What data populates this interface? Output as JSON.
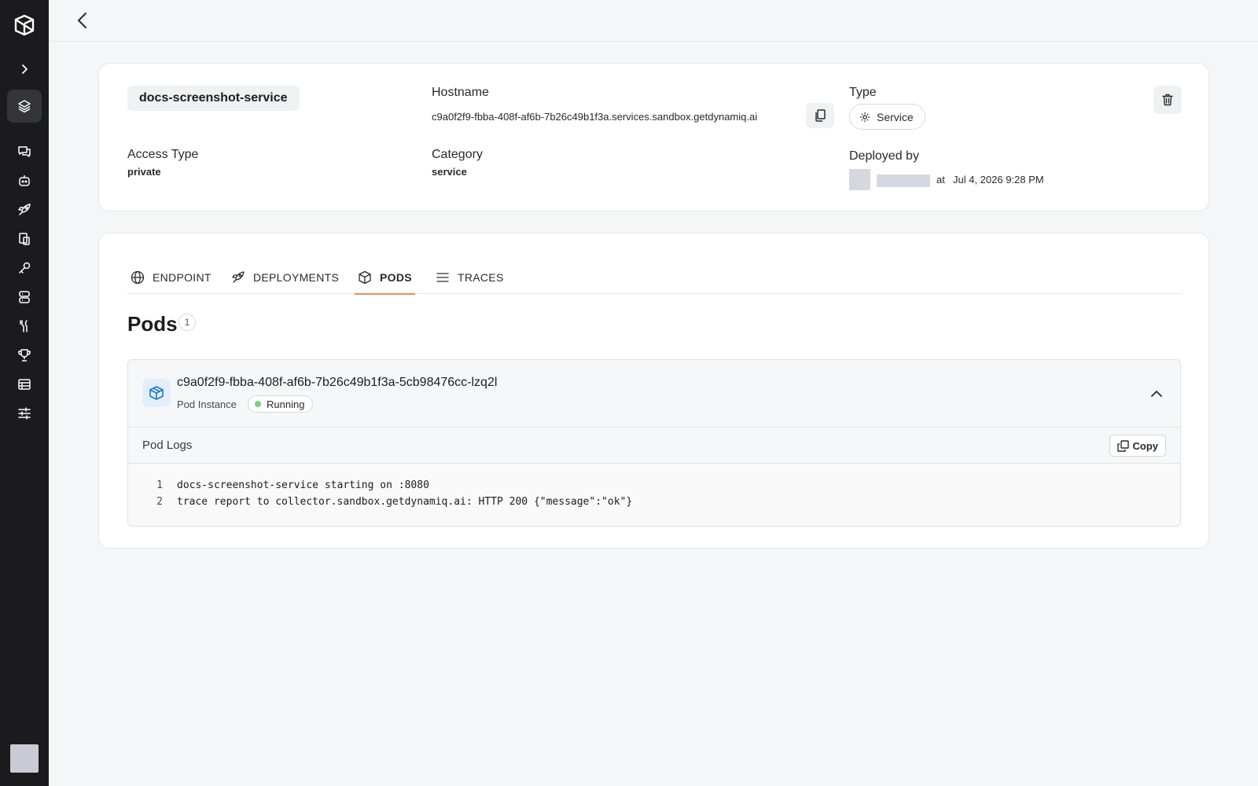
{
  "service": {
    "name": "docs-screenshot-service",
    "hostname_label": "Hostname",
    "hostname": "c9a0f2f9-fbba-408f-af6b-7b26c49b1f3a.services.sandbox.getdynamiq.ai",
    "type_label": "Type",
    "type_value": "Service",
    "access_type_label": "Access Type",
    "access_type": "private",
    "category_label": "Category",
    "category": "service",
    "deployed_by_label": "Deployed by",
    "deployed_at_prefix": "at",
    "deployed_at": "Jul 4, 2026 9:28 PM"
  },
  "tabs": [
    {
      "label": "ENDPOINT",
      "icon": "globe-icon"
    },
    {
      "label": "DEPLOYMENTS",
      "icon": "rocket-icon"
    },
    {
      "label": "PODS",
      "icon": "cube-icon",
      "active": true
    },
    {
      "label": "TRACES",
      "icon": "list-icon"
    }
  ],
  "pods": {
    "title": "Pods",
    "count": "1",
    "items": [
      {
        "name": "c9a0f2f9-fbba-408f-af6b-7b26c49b1f3a-5cb98476cc-lzq2l",
        "subtitle": "Pod Instance",
        "status": "Running",
        "status_color": "#7ccf7f"
      }
    ]
  },
  "logs": {
    "title": "Pod Logs",
    "copy_label": "Copy",
    "lines": [
      {
        "num": "1",
        "text": "docs-screenshot-service starting on :8080"
      },
      {
        "num": "2",
        "text": "trace report to collector.sandbox.getdynamiq.ai: HTTP 200 {\"message\":\"ok\"}"
      }
    ]
  },
  "sidebar": {
    "items": [
      "layers-icon",
      "chat-icon",
      "bot-icon",
      "rocket-icon",
      "documents-icon",
      "key-icon",
      "database-icon",
      "tools-icon",
      "trophy-icon",
      "table-icon",
      "sliders-icon"
    ]
  },
  "colors": {
    "sidebar_bg": "#1b1b1d",
    "accent": "#f08a60",
    "pod_icon": "#1f7ac9"
  }
}
